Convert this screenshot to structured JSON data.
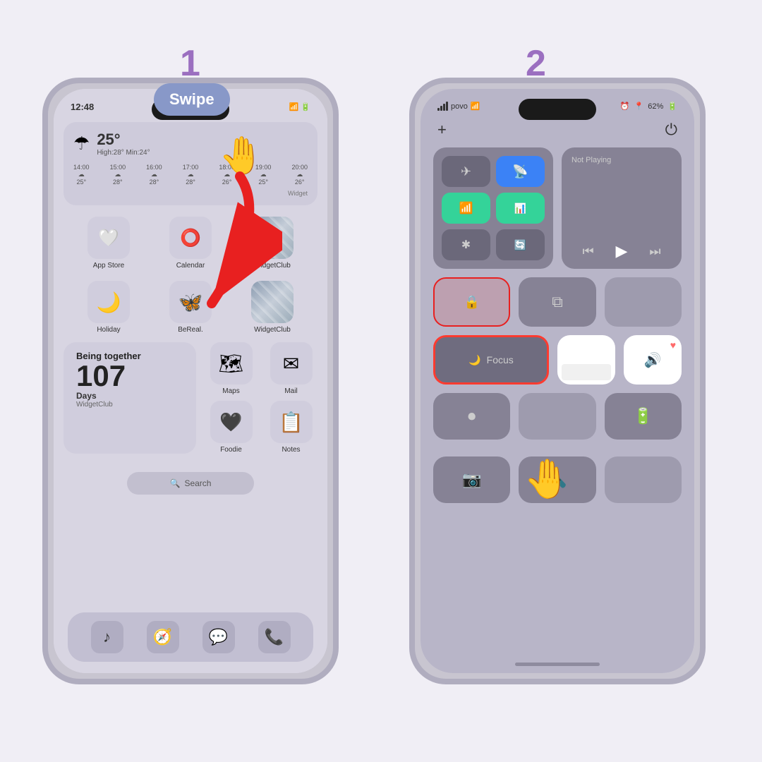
{
  "steps": {
    "step1": {
      "number": "1"
    },
    "step2": {
      "number": "2"
    }
  },
  "swipe_label": "Swipe",
  "phone1": {
    "time": "12:48",
    "weather": {
      "icon": "☂",
      "temp": "25°",
      "minmax": "High:28° Min:24°",
      "hours": [
        {
          "time": "14:00",
          "icon": "☁",
          "temp": "25°"
        },
        {
          "time": "15:00",
          "icon": "☁",
          "temp": "28°"
        },
        {
          "time": "16:00",
          "icon": "☁",
          "temp": "28°"
        },
        {
          "time": "17:00",
          "icon": "☁",
          "temp": "28°"
        },
        {
          "time": "18:00",
          "icon": "☁",
          "temp": "26°"
        },
        {
          "time": "19:00",
          "icon": "☁",
          "temp": "25°"
        },
        {
          "time": "20:00",
          "icon": "☁",
          "temp": "26°"
        }
      ],
      "widget_label": "Widget"
    },
    "apps_row1": [
      {
        "label": "App Store",
        "icon": "🤍"
      },
      {
        "label": "Calendar",
        "icon": "⭕"
      },
      {
        "label": "WidgetClub",
        "icon": "marble"
      }
    ],
    "apps_row2": [
      {
        "label": "Holiday",
        "icon": "🌙"
      },
      {
        "label": "BeReal.",
        "icon": "🦋"
      },
      {
        "label": "WidgetClub",
        "icon": "marble"
      }
    ],
    "countdown": {
      "title": "Being together",
      "days": "107",
      "days_label": "Days",
      "sub_label": "WidgetClub"
    },
    "apps_row3": [
      {
        "label": "Maps",
        "icon": "🗺"
      },
      {
        "label": "Mail",
        "icon": "✉"
      }
    ],
    "apps_row4": [
      {
        "label": "Foodie",
        "icon": "🖤"
      },
      {
        "label": "Notes",
        "icon": "📋"
      }
    ],
    "search_placeholder": "Search",
    "dock": [
      {
        "icon": "♪",
        "label": "Music"
      },
      {
        "icon": "🧭",
        "label": "Safari"
      },
      {
        "icon": "💬",
        "label": "Messages"
      },
      {
        "icon": "📞",
        "label": "Phone"
      }
    ]
  },
  "phone2": {
    "status": {
      "signal": "povo",
      "wifi": true,
      "alarm": true,
      "battery": "62%"
    },
    "cc": {
      "not_playing": "Not Playing",
      "focus_label": "Focus"
    }
  }
}
